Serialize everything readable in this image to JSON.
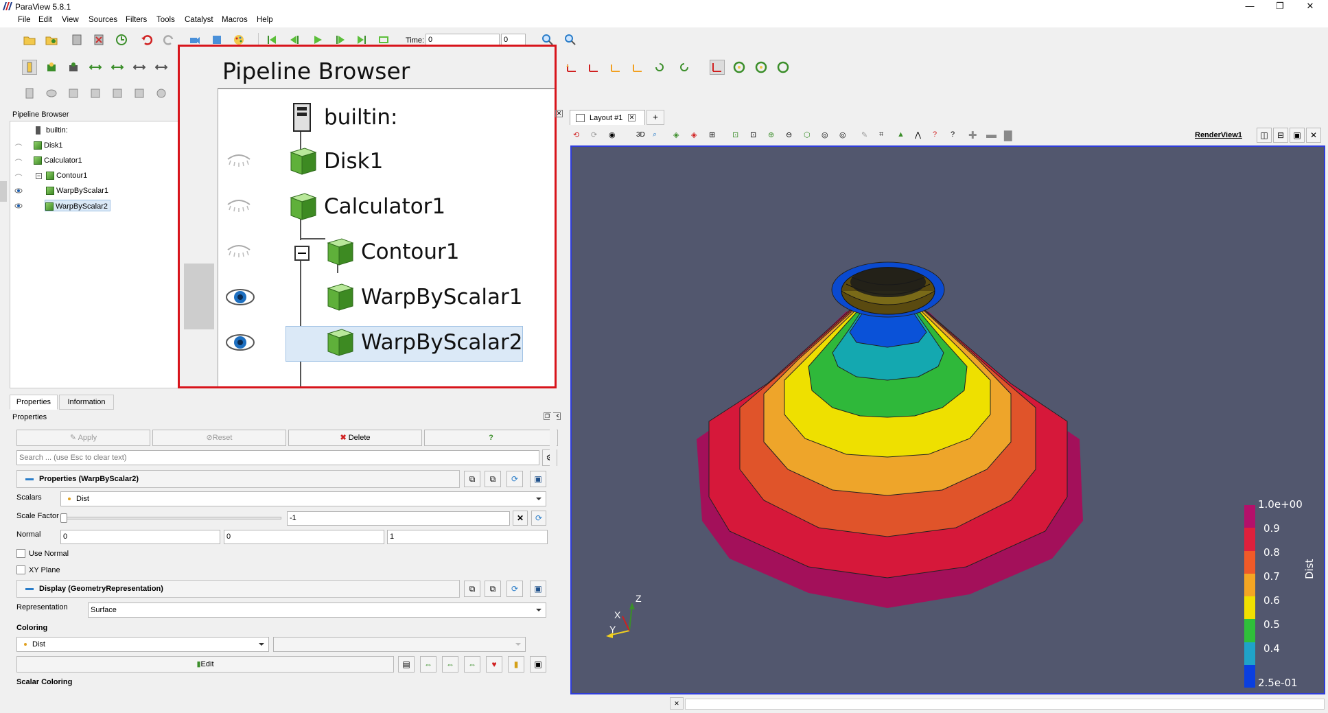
{
  "window": {
    "title": "ParaView 5.8.1"
  },
  "menubar": [
    "File",
    "Edit",
    "View",
    "Sources",
    "Filters",
    "Tools",
    "Catalyst",
    "Macros",
    "Help"
  ],
  "toolbar": {
    "time_label": "Time:",
    "time_value": "0",
    "time_index": "0"
  },
  "pipeline": {
    "panel_title": "Pipeline Browser",
    "items": [
      {
        "label": "builtin:",
        "visible": null
      },
      {
        "label": "Disk1",
        "visible": false
      },
      {
        "label": "Calculator1",
        "visible": false
      },
      {
        "label": "Contour1",
        "visible": false
      },
      {
        "label": "WarpByScalar1",
        "visible": true
      },
      {
        "label": "WarpByScalar2",
        "visible": true,
        "selected": true
      }
    ]
  },
  "callout": {
    "title": "Pipeline Browser",
    "items": [
      "builtin:",
      "Disk1",
      "Calculator1",
      "Contour1",
      "WarpByScalar1",
      "WarpByScalar2"
    ]
  },
  "properties": {
    "tabs": [
      "Properties",
      "Information"
    ],
    "panel_title": "Properties",
    "apply": "Apply",
    "reset": "Reset",
    "delete": "Delete",
    "help": "?",
    "search_placeholder": "Search ... (use Esc to clear text)",
    "section_props": "Properties (WarpByScalar2)",
    "scalars_label": "Scalars",
    "scalars_value": "Dist",
    "scale_factor_label": "Scale Factor",
    "scale_factor_value": "-1",
    "normal_label": "Normal",
    "normal_values": [
      "0",
      "0",
      "1"
    ],
    "use_normal": "Use Normal",
    "xy_plane": "XY Plane",
    "section_display": "Display (GeometryRepresentation)",
    "representation_label": "Representation",
    "representation_value": "Surface",
    "coloring_label": "Coloring",
    "coloring_value": "Dist",
    "coloring_value2": "",
    "edit": "Edit",
    "scalar_coloring": "Scalar Coloring"
  },
  "view": {
    "layout_tab": "Layout #1",
    "plus": "+",
    "three_d": "3D",
    "render_view": "RenderView1",
    "background": "#52576e"
  },
  "legend": {
    "title": "Dist",
    "ticks": [
      "1.0e+00",
      "0.9",
      "0.8",
      "0.7",
      "0.6",
      "0.5",
      "0.4",
      "2.5e-01"
    ],
    "colors": [
      "#b4106a",
      "#e0203c",
      "#f05a28",
      "#f5a623",
      "#f0e000",
      "#2fbf3a",
      "#1fa3c8",
      "#0a3fe0"
    ]
  },
  "axes": {
    "x": "X",
    "y": "Y",
    "z": "Z"
  }
}
